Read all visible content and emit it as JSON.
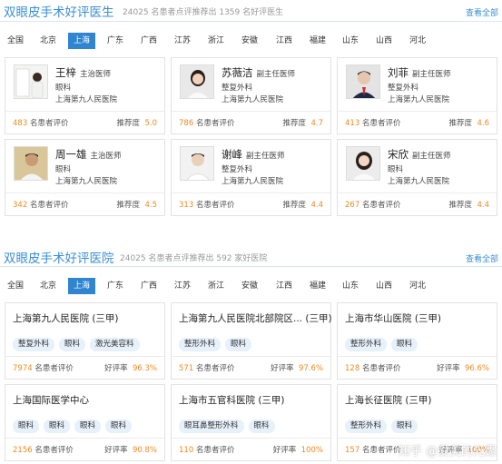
{
  "doctor_section": {
    "title": "双眼皮手术好评医生",
    "subtitle": "24025 名患者点评推荐出 1359 名好评医生",
    "more": "查看全部",
    "tabs": [
      "全国",
      "北京",
      "上海",
      "广东",
      "广西",
      "江苏",
      "浙江",
      "安徽",
      "江西",
      "福建",
      "山东",
      "山西",
      "河北"
    ],
    "active_tab": "上海",
    "doctors": [
      {
        "name": "王梓",
        "title": "主治医师",
        "dept": "眼科",
        "hospital": "上海第九人民医院",
        "reviews": "483",
        "reviews_label": "名患者评价",
        "rec_label": "推荐度",
        "rec": "5.0"
      },
      {
        "name": "苏薇洁",
        "title": "副主任医师",
        "dept": "整复外科",
        "hospital": "上海第九人民医院",
        "reviews": "786",
        "reviews_label": "名患者评价",
        "rec_label": "推荐度",
        "rec": "4.7"
      },
      {
        "name": "刘菲",
        "title": "副主任医师",
        "dept": "整复外科",
        "hospital": "上海第九人民医院",
        "reviews": "413",
        "reviews_label": "名患者评价",
        "rec_label": "推荐度",
        "rec": "4.6"
      },
      {
        "name": "周一雄",
        "title": "主治医师",
        "dept": "眼科",
        "hospital": "上海第九人民医院",
        "reviews": "342",
        "reviews_label": "名患者评价",
        "rec_label": "推荐度",
        "rec": "4.5"
      },
      {
        "name": "谢峰",
        "title": "副主任医师",
        "dept": "整复外科",
        "hospital": "上海第九人民医院",
        "reviews": "313",
        "reviews_label": "名患者评价",
        "rec_label": "推荐度",
        "rec": "4.4"
      },
      {
        "name": "宋欣",
        "title": "副主任医师",
        "dept": "眼科",
        "hospital": "上海第九人民医院",
        "reviews": "267",
        "reviews_label": "名患者评价",
        "rec_label": "推荐度",
        "rec": "4.4"
      }
    ]
  },
  "hospital_section": {
    "title": "双眼皮手术好评医院",
    "subtitle": "24025 名患者点评推荐出 592 家好医院",
    "more": "查看全部",
    "tabs": [
      "全国",
      "北京",
      "上海",
      "广东",
      "广西",
      "江苏",
      "浙江",
      "安徽",
      "江西",
      "福建",
      "山东",
      "山西",
      "河北"
    ],
    "active_tab": "上海",
    "hospitals": [
      {
        "name": "上海第九人民医院 (三甲)",
        "tags": [
          "整复外科",
          "眼科",
          "激光美容科"
        ],
        "reviews": "7974",
        "reviews_label": "名患者评价",
        "rate_label": "好评率",
        "rate": "96.3%"
      },
      {
        "name": "上海第九人民医院北部院区... (三甲)",
        "tags": [
          "整形外科",
          "眼科"
        ],
        "reviews": "571",
        "reviews_label": "名患者评价",
        "rate_label": "好评率",
        "rate": "97.6%"
      },
      {
        "name": "上海市华山医院 (三甲)",
        "tags": [
          "整形外科",
          "眼科"
        ],
        "reviews": "128",
        "reviews_label": "名患者评价",
        "rate_label": "好评率",
        "rate": "96.6%"
      },
      {
        "name": "上海国际医学中心",
        "tags": [
          "眼科",
          "眼科",
          "眼科",
          "眼科"
        ],
        "reviews": "2156",
        "reviews_label": "名患者评价",
        "rate_label": "好评率",
        "rate": "90.8%"
      },
      {
        "name": "上海市五官科医院 (三甲)",
        "tags": [
          "眼耳鼻整形外科",
          "眼科"
        ],
        "reviews": "110",
        "reviews_label": "名患者评价",
        "rate_label": "好评率",
        "rate": "100%"
      },
      {
        "name": "上海长征医院 (三甲)",
        "tags": [
          "整形外科",
          "眼科"
        ],
        "reviews": "157",
        "reviews_label": "名患者评价",
        "rate_label": "好评率",
        "rate": "100%"
      }
    ]
  },
  "watermark": "知乎 @爱美的光霞",
  "colors": {
    "accent": "#2f85d0",
    "title_blue": "#3a8fd6",
    "number_orange": "#f08a20",
    "tag_bg": "#e7f1fb"
  }
}
